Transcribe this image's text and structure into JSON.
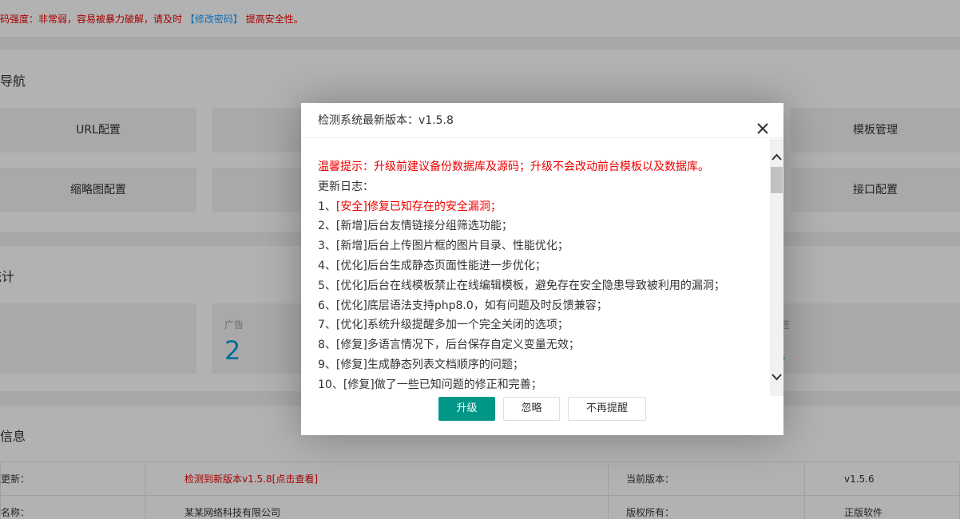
{
  "page": {
    "warning": {
      "prefix": "密码强度：非常弱，容易被暴力破解，请及时",
      "link": "【修改密码】",
      "suffix": "提高安全性。"
    },
    "nav_section": {
      "title": "快捷导航",
      "tiles": [
        "URL配置",
        "模板管理",
        "缩略图配置",
        "接口配置"
      ]
    },
    "stats_section": {
      "title": "统计",
      "tiles": [
        {
          "label": "广告",
          "value": "2"
        },
        {
          "label": "标签",
          "value": "1"
        }
      ]
    },
    "info_section": {
      "title": "系统信息",
      "rows": [
        {
          "label": "系统更新：",
          "value": "检测到新版本v1.5.8[点击查看]",
          "label2": "当前版本：",
          "value2": "v1.5.6"
        },
        {
          "label": "网站名称：",
          "value": "某某网络科技有限公司",
          "label2": "版权所有：",
          "value2": "正版软件"
        }
      ]
    }
  },
  "dialog": {
    "title": "检测系统最新版本：v1.5.8",
    "notice": "温馨提示：升级前建议备份数据库及源码；升级不会改动前台模板以及数据库。",
    "log_heading": "更新日志：",
    "first_item_prefix": "1、",
    "first_item_text": "[安全]修复已知存在的安全漏洞；",
    "items": [
      "2、[新增]后台友情链接分组筛选功能；",
      "3、[新增]后台上传图片框的图片目录、性能优化；",
      "4、[优化]后台生成静态页面性能进一步优化；",
      "5、[优化]后台在线模板禁止在线编辑模板，避免存在安全隐患导致被利用的漏洞；",
      "6、[优化]底层语法支持php8.0，如有问题及时反馈兼容；",
      "7、[优化]系统升级提醒多加一个完全关闭的选项；",
      "8、[修复]多语言情况下，后台保存自定义变量无效；",
      "9、[修复]生成静态列表文档顺序的问题；",
      "10、[修复]做了一些已知问题的修正和完善；"
    ],
    "buttons": {
      "upgrade": "升级",
      "ignore": "忽略",
      "never": "不再提醒"
    }
  },
  "colors": {
    "primary": "#009688",
    "danger": "#ee0000",
    "link": "#1e9fff",
    "stat": "#009fd9"
  }
}
